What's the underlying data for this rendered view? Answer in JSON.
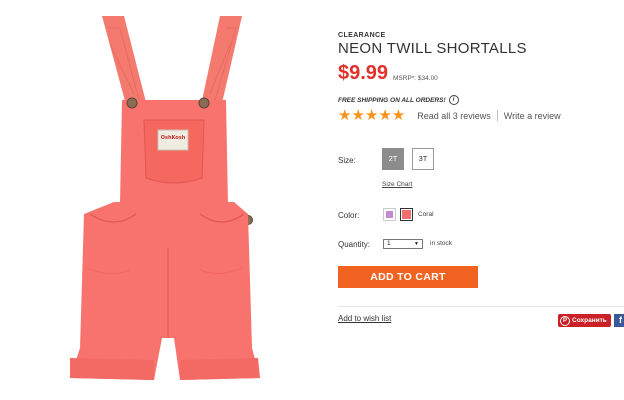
{
  "product": {
    "badge": "CLEARANCE",
    "title": "NEON TWILL SHORTALLS",
    "price": "$9.99",
    "msrp": "MSRP*: $34.00",
    "shipping": "FREE SHIPPING ON ALL ORDERS!",
    "info_icon": "i",
    "brand_label": "OshKosh",
    "image_subject": "coral overall shorts"
  },
  "rating": {
    "stars": "★★★★★",
    "reviews_link": "Read all 3 reviews",
    "write_review": "Write a review"
  },
  "size": {
    "label": "Size:",
    "options": [
      "2T",
      "3T"
    ],
    "selected": "2T",
    "chart_link": "Size Chart"
  },
  "color": {
    "label": "Color:",
    "swatches": [
      "lilac",
      "coral"
    ],
    "selected_name": "Coral",
    "colors": {
      "lilac": "#c58ad6",
      "coral": "#f36f6e"
    }
  },
  "quantity": {
    "label": "Quantity:",
    "value": "1",
    "caret": "▼",
    "stock": "in stock"
  },
  "actions": {
    "add_to_cart": "ADD TO CART",
    "wishlist": "Add to wish list",
    "pinterest": "Сохранить",
    "pinterest_icon": "P",
    "facebook_icon": "f"
  },
  "colors": {
    "price_red": "#e2322b",
    "cta_orange": "#f26321",
    "star_orange": "#f7941d",
    "product_coral": "#f8736e",
    "pinterest_red": "#cb2027",
    "facebook_blue": "#3b5998"
  }
}
